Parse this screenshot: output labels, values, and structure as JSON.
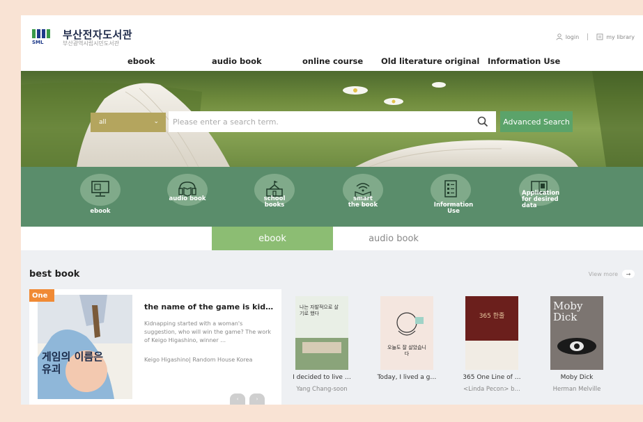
{
  "header": {
    "logo_name": "부산전자도서관",
    "logo_sub": "부산광역시립시민도서관",
    "logo_abbr": "SML",
    "login_label": "login",
    "my_library_label": "my library"
  },
  "nav": {
    "items": [
      "ebook",
      "audio book",
      "online course",
      "Old literature original",
      "Information Use"
    ]
  },
  "search": {
    "category_value": "all",
    "placeholder": "Please enter a search term.",
    "advanced_label": "Advanced Search"
  },
  "categories": [
    {
      "label": "ebook",
      "icon": "monitor-icon"
    },
    {
      "label": "audio book",
      "icon": "audio-book-icon"
    },
    {
      "label": "school books",
      "icon": "school-icon"
    },
    {
      "label": "smart the book",
      "icon": "smart-book-icon"
    },
    {
      "label": "Information Use",
      "icon": "document-list-icon"
    },
    {
      "label": "Application for desired data",
      "icon": "book-request-icon"
    }
  ],
  "tabs": {
    "active": "ebook",
    "inactive": "audio book"
  },
  "best": {
    "title": "best book",
    "view_more": "View more",
    "feature": {
      "badge": "One",
      "title": "the name of the game is kid…",
      "description": "Kidnapping started with a woman's suggestion, who will win the game? The work of Keigo Higashino, winner …",
      "author": "Keigo Higashino| Random House Korea",
      "cover_text": "게임의 이름은 유괴"
    },
    "books": [
      {
        "title": "I decided to live …",
        "author": "Yang Chang-soon",
        "cover_text": "나는 자발적으로 살기로 했다"
      },
      {
        "title": "Today, I lived a g…",
        "author": "",
        "cover_text": "오늘도 잘 살았습니다"
      },
      {
        "title": "365 One Line of …",
        "author": "<Linda Pecon> b…",
        "cover_text": "365 한줄"
      },
      {
        "title": "Moby Dick",
        "author": "Herman Melville",
        "cover_text": "Moby Dick"
      }
    ]
  },
  "colors": {
    "accent_green": "#5ba36a",
    "band_green": "#5a8d6b",
    "tab_green": "#8cbd73",
    "badge_orange": "#f08a35",
    "page_bg": "#f9e3d4"
  }
}
